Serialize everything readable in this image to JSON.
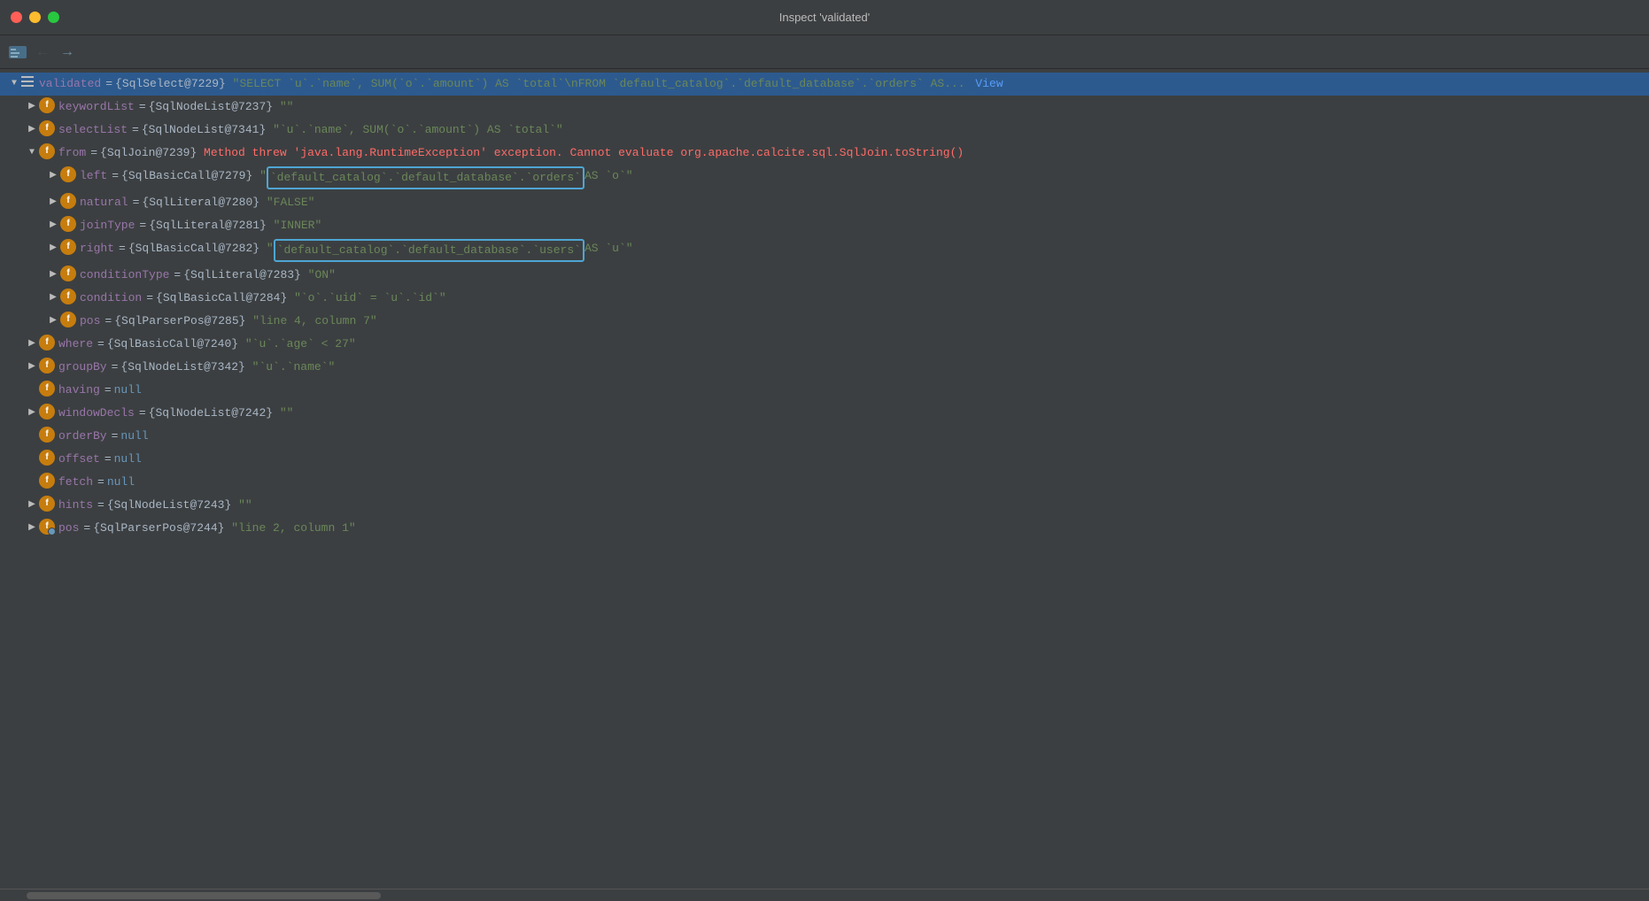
{
  "window": {
    "title": "Inspect 'validated'"
  },
  "toolbar": {
    "back_label": "←",
    "forward_label": "→"
  },
  "tree": {
    "root": {
      "key": "validated",
      "type_ref": "{SqlSelect@7229}",
      "value_preview": "\"SELECT `u`.`name`, SUM(`o`.`amount`) AS `total`\\nFROM `default_catalog`.`default_database`.`orders` AS...",
      "view_label": "View"
    },
    "items": [
      {
        "id": "keywordList",
        "indent": 1,
        "expandable": true,
        "key": "keywordList",
        "type_ref": "{SqlNodeList@7237}",
        "value": "\"\""
      },
      {
        "id": "selectList",
        "indent": 1,
        "expandable": true,
        "key": "selectList",
        "type_ref": "{SqlNodeList@7341}",
        "value": "\"`u`.`name`, SUM(`o`.`amount`) AS `total`\""
      },
      {
        "id": "from",
        "indent": 1,
        "expandable": true,
        "expanded": true,
        "key": "from",
        "type_ref": "{SqlJoin@7239}",
        "error": "Method threw 'java.lang.RuntimeException' exception. Cannot evaluate org.apache.calcite.sql.SqlJoin.toString()"
      },
      {
        "id": "left",
        "indent": 2,
        "expandable": true,
        "key": "left",
        "type_ref": "{SqlBasicCall@7279}",
        "value_highlighted": "`default_catalog`.`default_database`.`orders`",
        "value_rest": " AS `o`\""
      },
      {
        "id": "natural",
        "indent": 2,
        "expandable": true,
        "key": "natural",
        "type_ref": "{SqlLiteral@7280}",
        "value": "\"FALSE\""
      },
      {
        "id": "joinType",
        "indent": 2,
        "expandable": true,
        "key": "joinType",
        "type_ref": "{SqlLiteral@7281}",
        "value": "\"INNER\""
      },
      {
        "id": "right",
        "indent": 2,
        "expandable": true,
        "key": "right",
        "type_ref": "{SqlBasicCall@7282}",
        "value_highlighted": "`default_catalog`.`default_database`.`users`",
        "value_rest": " AS `u`\""
      },
      {
        "id": "conditionType",
        "indent": 2,
        "expandable": true,
        "key": "conditionType",
        "type_ref": "{SqlLiteral@7283}",
        "value": "\"ON\""
      },
      {
        "id": "condition",
        "indent": 2,
        "expandable": true,
        "key": "condition",
        "type_ref": "{SqlBasicCall@7284}",
        "value": "\"`o`.`uid` = `u`.`id`\""
      },
      {
        "id": "pos_inner",
        "indent": 2,
        "expandable": true,
        "key": "pos",
        "type_ref": "{SqlParserPos@7285}",
        "value": "\"line 4, column 7\""
      },
      {
        "id": "where",
        "indent": 1,
        "expandable": true,
        "key": "where",
        "type_ref": "{SqlBasicCall@7240}",
        "value": "\"`u`.`age` < 27\""
      },
      {
        "id": "groupBy",
        "indent": 1,
        "expandable": true,
        "key": "groupBy",
        "type_ref": "{SqlNodeList@7342}",
        "value": "\"`u`.`name`\""
      },
      {
        "id": "having",
        "indent": 1,
        "expandable": false,
        "key": "having",
        "value": "null"
      },
      {
        "id": "windowDecls",
        "indent": 1,
        "expandable": true,
        "key": "windowDecls",
        "type_ref": "{SqlNodeList@7242}",
        "value": "\"\""
      },
      {
        "id": "orderBy",
        "indent": 1,
        "expandable": false,
        "key": "orderBy",
        "value": "null"
      },
      {
        "id": "offset",
        "indent": 1,
        "expandable": false,
        "key": "offset",
        "value": "null"
      },
      {
        "id": "fetch",
        "indent": 1,
        "expandable": false,
        "key": "fetch",
        "value": "null"
      },
      {
        "id": "hints",
        "indent": 1,
        "expandable": true,
        "key": "hints",
        "type_ref": "{SqlNodeList@7243}",
        "value": "\"\""
      },
      {
        "id": "pos_outer",
        "indent": 1,
        "expandable": true,
        "special_icon": true,
        "key": "pos",
        "type_ref": "{SqlParserPos@7244}",
        "value": "\"line 2, column 1\""
      }
    ]
  }
}
